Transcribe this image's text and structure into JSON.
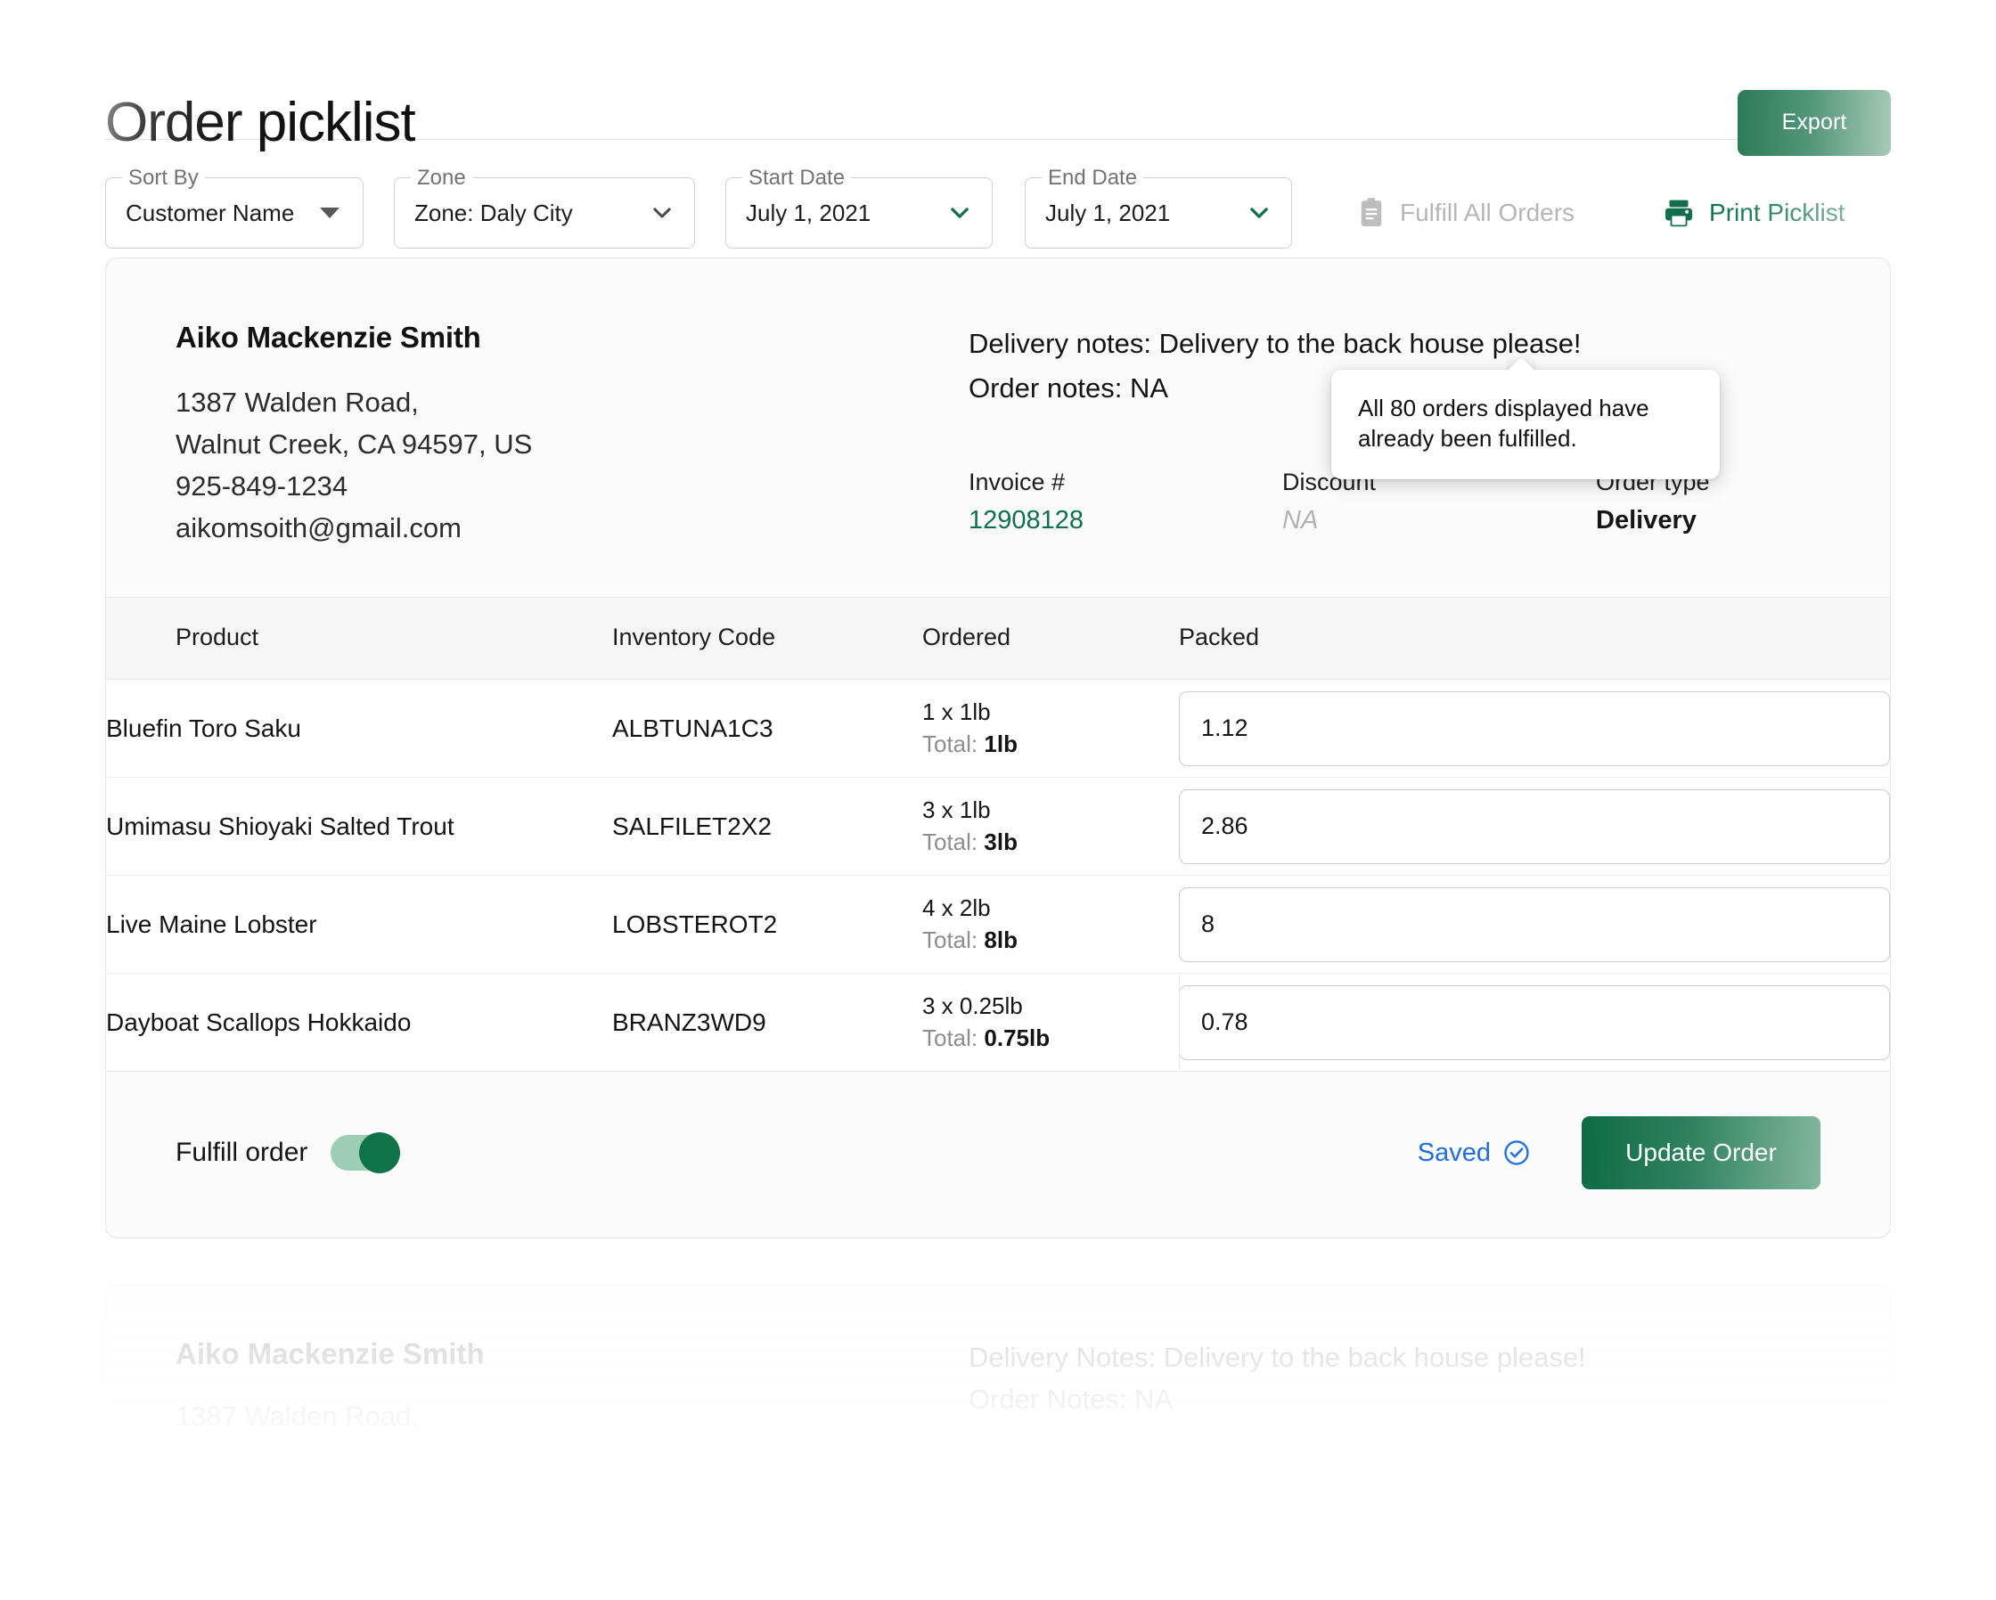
{
  "header": {
    "title": "Order picklist",
    "export_label": "Export"
  },
  "toolbar": {
    "sort_by": {
      "label": "Sort By",
      "value": "Customer Name",
      "icon": "caret-down-icon"
    },
    "zone": {
      "label": "Zone",
      "value": "Zone: Daly City",
      "icon": "chevron-down-icon"
    },
    "start_date": {
      "label": "Start Date",
      "value": "July 1, 2021",
      "icon": "chevron-down-icon"
    },
    "end_date": {
      "label": "End Date",
      "value": "July 1, 2021",
      "icon": "chevron-down-icon"
    },
    "fulfill_all": {
      "label": "Fulfill All Orders",
      "icon": "clipboard-icon",
      "disabled": true
    },
    "print_picklist": {
      "label": "Print Picklist",
      "icon": "printer-icon"
    }
  },
  "tooltip": {
    "text": "All 80 orders displayed have already been fulfilled."
  },
  "order": {
    "customer": {
      "name": "Aiko Mackenzie Smith",
      "address_line1": "1387 Walden Road,",
      "address_line2": "Walnut Creek, CA 94597, US",
      "phone": "925-849-1234",
      "email": "aikomsoith@gmail.com"
    },
    "notes": {
      "delivery_label": "Delivery notes:",
      "delivery_value": "Delivery to the back house please!",
      "order_label": "Order notes:",
      "order_value": "NA"
    },
    "meta": {
      "invoice_label": "Invoice #",
      "invoice_value": "12908128",
      "discount_label": "Discount",
      "discount_value": "NA",
      "order_type_label": "Order type",
      "order_type_value": "Delivery"
    },
    "table": {
      "columns": [
        "Product",
        "Inventory Code",
        "Ordered",
        "Packed"
      ],
      "rows": [
        {
          "product": "Bluefin Toro Saku",
          "code": "ALBTUNA1C3",
          "ordered_qty": "1 x 1lb",
          "total_label": "Total:",
          "total_value": "1lb",
          "packed": "1.12"
        },
        {
          "product": "Umimasu Shioyaki Salted Trout",
          "code": "SALFILET2X2",
          "ordered_qty": "3 x 1lb",
          "total_label": "Total:",
          "total_value": "3lb",
          "packed": "2.86"
        },
        {
          "product": "Live Maine Lobster",
          "code": "LOBSTEROT2",
          "ordered_qty": "4 x 2lb",
          "total_label": "Total:",
          "total_value": "8lb",
          "packed": "8"
        },
        {
          "product": "Dayboat Scallops Hokkaido",
          "code": "BRANZ3WD9",
          "ordered_qty": "3 x 0.25lb",
          "total_label": "Total:",
          "total_value": "0.75lb",
          "packed": "0.78"
        }
      ]
    },
    "footer": {
      "fulfill_label": "Fulfill order",
      "fulfill_on": true,
      "saved_label": "Saved",
      "saved_icon": "check-circle-icon",
      "update_label": "Update Order"
    }
  },
  "next_order_preview": {
    "name": "Aiko Mackenzie Smith",
    "address_line1": "1387 Walden Road,",
    "delivery_notes": "Delivery Notes: Delivery to the back house please!",
    "order_notes": "Order Notes: NA"
  },
  "colors": {
    "brand_green": "#11704b",
    "link_blue": "#1f6fe0",
    "muted_gray": "#b2b2b2"
  }
}
